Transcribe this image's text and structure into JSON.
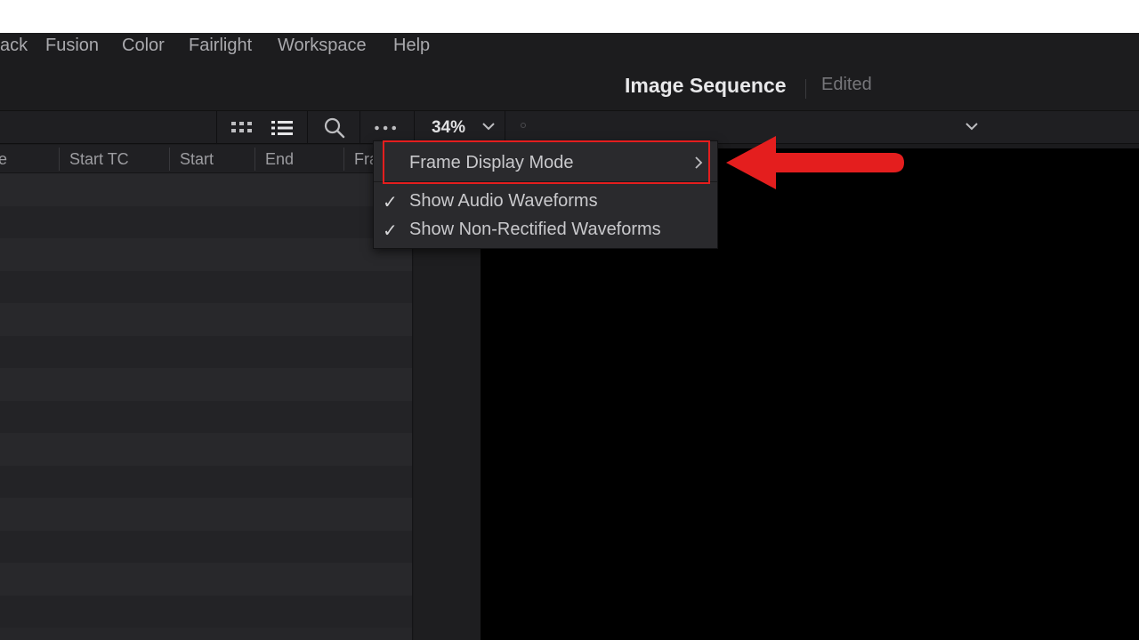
{
  "menu": {
    "items": [
      {
        "label": "ack"
      },
      {
        "label": "Fusion"
      },
      {
        "label": "Color"
      },
      {
        "label": "Fairlight"
      },
      {
        "label": "Workspace"
      },
      {
        "label": "Help"
      }
    ]
  },
  "header": {
    "project_title": "Image Sequence",
    "status": "Edited"
  },
  "toolbar": {
    "zoom": "34%",
    "icons": [
      "grid-view-icon",
      "list-view-icon",
      "search-icon",
      "more-options-icon",
      "chevron-down-icon"
    ]
  },
  "media_pool": {
    "columns": [
      {
        "label": "e"
      },
      {
        "label": "Start TC"
      },
      {
        "label": "Start"
      },
      {
        "label": "End"
      },
      {
        "label": "Fra"
      }
    ]
  },
  "dropdown": {
    "items": [
      {
        "label": "Frame Display Mode",
        "checked": false,
        "has_submenu": true
      },
      {
        "label": "Show Audio Waveforms",
        "checked": true,
        "has_submenu": false
      },
      {
        "label": "Show Non-Rectified Waveforms",
        "checked": true,
        "has_submenu": false
      }
    ],
    "check_glyph": "✓"
  },
  "annotation": {
    "color": "#e41e1e"
  }
}
